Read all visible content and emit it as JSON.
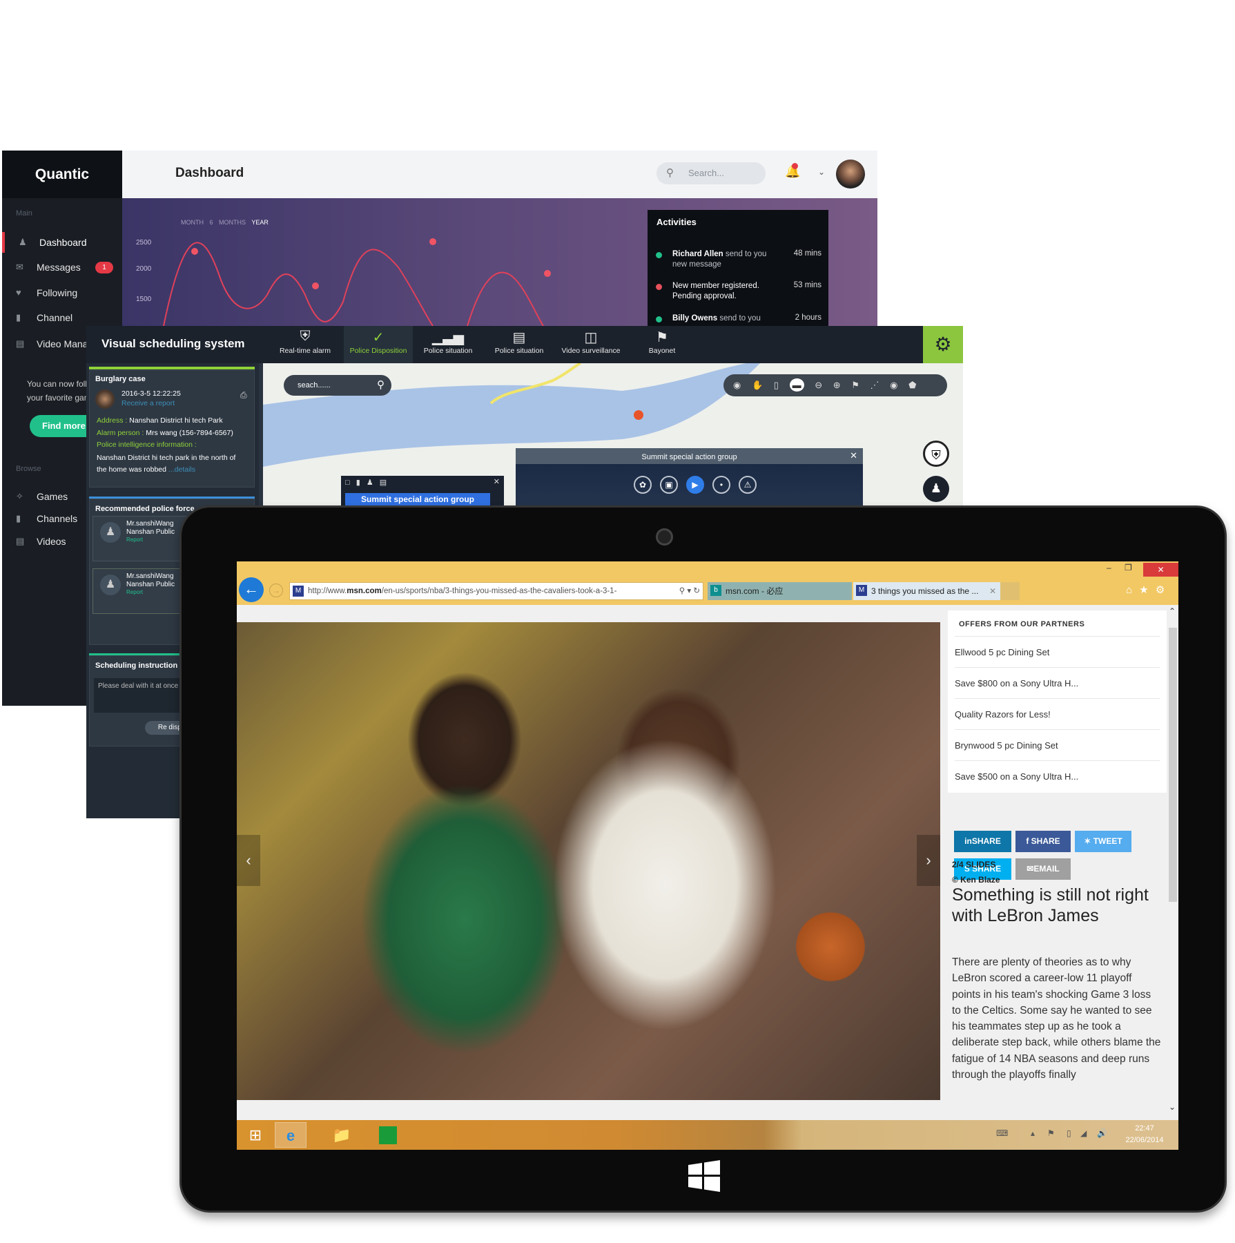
{
  "dashboard": {
    "logo": "Quantic",
    "title": "Dashboard",
    "search_placeholder": "Search...",
    "sidebar": {
      "main_label": "Main",
      "items": [
        {
          "label": "Dashboard",
          "icon": "user-icon"
        },
        {
          "label": "Messages",
          "icon": "mail-icon",
          "badge": "1"
        },
        {
          "label": "Following",
          "icon": "heart-icon"
        },
        {
          "label": "Channel",
          "icon": "video-icon"
        },
        {
          "label": "Video Manag",
          "icon": "film-icon"
        }
      ],
      "promo_line1": "You can now foll",
      "promo_line2": "your favorite gam",
      "find_more": "Find more!",
      "browse_label": "Browse",
      "browse_items": [
        {
          "label": "Games",
          "icon": "gamepad-icon"
        },
        {
          "label": "Channels",
          "icon": "camera-icon"
        },
        {
          "label": "Videos",
          "icon": "folder-icon"
        }
      ]
    },
    "chart": {
      "ranges": [
        "MONTH",
        "6 MONTHS",
        "YEAR"
      ],
      "active_range": "YEAR",
      "y_ticks": [
        "2500",
        "2000",
        "1500"
      ],
      "line_color": "#e0415a"
    },
    "activities": {
      "title": "Activities",
      "items": [
        {
          "name": "Richard Allen",
          "text": "send to you new message",
          "time": "48 mins",
          "color": "#21c08a"
        },
        {
          "name": "",
          "text": "New member registered. Pending approval.",
          "time": "53 mins",
          "color": "#e5505a"
        },
        {
          "name": "Billy Owens",
          "text": "send to you",
          "time": "2 hours",
          "color": "#21c08a"
        }
      ]
    }
  },
  "scheduling": {
    "title": "Visual scheduling system",
    "nav": [
      {
        "label": "Real-time alarm",
        "icon": "shield-icon"
      },
      {
        "label": "Police Disposition",
        "icon": "shield-check-icon",
        "active": true
      },
      {
        "label": "Police situation",
        "icon": "bar-chart-icon"
      },
      {
        "label": "Police situation",
        "icon": "document-icon"
      },
      {
        "label": "Video surveillance",
        "icon": "camera-icon"
      },
      {
        "label": "Bayonet",
        "icon": "flag-icon"
      }
    ],
    "case": {
      "title": "Burglary case",
      "datetime": "2016-3-5  12:22:25",
      "status": "Receive a report",
      "address_label": "Address :",
      "address": "Nanshan District hi tech Park",
      "alarm_label": "Alarm person :",
      "alarm": "Mrs wang (156-7894-6567)",
      "intel_label": "Police intelligence information :",
      "intel_line1": "Nanshan District hi tech park in the north of",
      "intel_line2": "the home was robbed",
      "details": "...details"
    },
    "recommended": {
      "title": "Recommended police force",
      "officers": [
        {
          "name": "Mr.sanshiWang",
          "unit": "Nanshan Public",
          "action": "Report"
        },
        {
          "name": "Mr.sanshiWang",
          "unit": "Nanshan Public",
          "action": "Report"
        }
      ]
    },
    "instruction": {
      "title": "Scheduling instruction",
      "text": "Please deal with it at once",
      "button": "Re dispat"
    },
    "map": {
      "search_placeholder": "seach......",
      "dialog_title": "Summit special action group",
      "small_button": "Summit special action group"
    }
  },
  "browser": {
    "url_prefix": "http://www.",
    "url_domain": "msn.com",
    "url_rest": "/en-us/sports/nba/3-things-you-missed-as-the-cavaliers-took-a-3-1-",
    "tabs": [
      {
        "label": "msn.com - 必应",
        "active": false
      },
      {
        "label": "3 things you missed as the ...",
        "active": true
      }
    ],
    "offers": {
      "title": "OFFERS FROM OUR PARTNERS",
      "items": [
        "Ellwood 5 pc Dining Set",
        "Save $800 on a Sony Ultra H...",
        "Quality Razors for Less!",
        "Brynwood 5 pc Dining Set",
        "Save $500 on a Sony Ultra H..."
      ]
    },
    "share": [
      {
        "label": "SHARE",
        "icon": "linkedin-icon",
        "color": "#0e76a8"
      },
      {
        "label": "SHARE",
        "icon": "facebook-icon",
        "color": "#3b5998"
      },
      {
        "label": "TWEET",
        "icon": "twitter-icon",
        "color": "#55acee"
      },
      {
        "label": "SHARE",
        "icon": "skype-icon",
        "color": "#00aff0"
      },
      {
        "label": "EMAIL",
        "icon": "mail-icon",
        "color": "#a0a0a0"
      }
    ],
    "slides": "2/4 SLIDES",
    "credit": "© Ken Blaze",
    "headline": "Something is still not right with LeBron James",
    "body": "There are plenty of theories as to why LeBron scored a career-low 11 playoff points in his team's shocking Game 3 loss to the Celtics. Some say he wanted to see his teammates step up as he took a deliberate step back, while others blame the fatigue of 14 NBA seasons and deep runs through the playoffs finally"
  },
  "taskbar": {
    "time": "22:47",
    "date": "22/06/2014"
  }
}
